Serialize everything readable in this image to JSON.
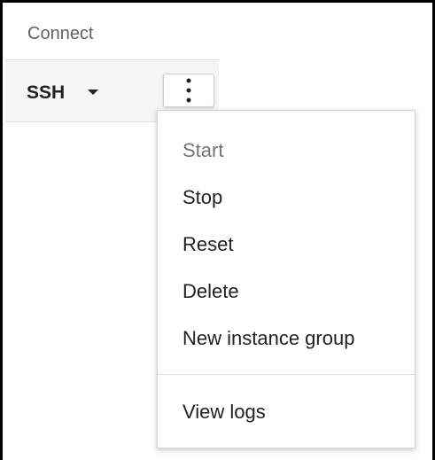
{
  "header": {
    "title": "Connect"
  },
  "connect_row": {
    "ssh_label": "SSH",
    "dropdown_icon": "caret-down-icon",
    "more_icon": "more-vert-icon"
  },
  "menu": {
    "items": [
      {
        "label": "Start",
        "state": "disabled"
      },
      {
        "label": "Stop",
        "state": "enabled"
      },
      {
        "label": "Reset",
        "state": "enabled"
      },
      {
        "label": "Delete",
        "state": "enabled"
      },
      {
        "label": "New instance group",
        "state": "enabled"
      },
      {
        "label": "View logs",
        "state": "enabled"
      }
    ]
  },
  "colors": {
    "text_primary": "#212121",
    "text_disabled": "#757575",
    "header_text": "#616161",
    "row_background": "#f5f5f5",
    "divider": "#e0e0e0"
  }
}
